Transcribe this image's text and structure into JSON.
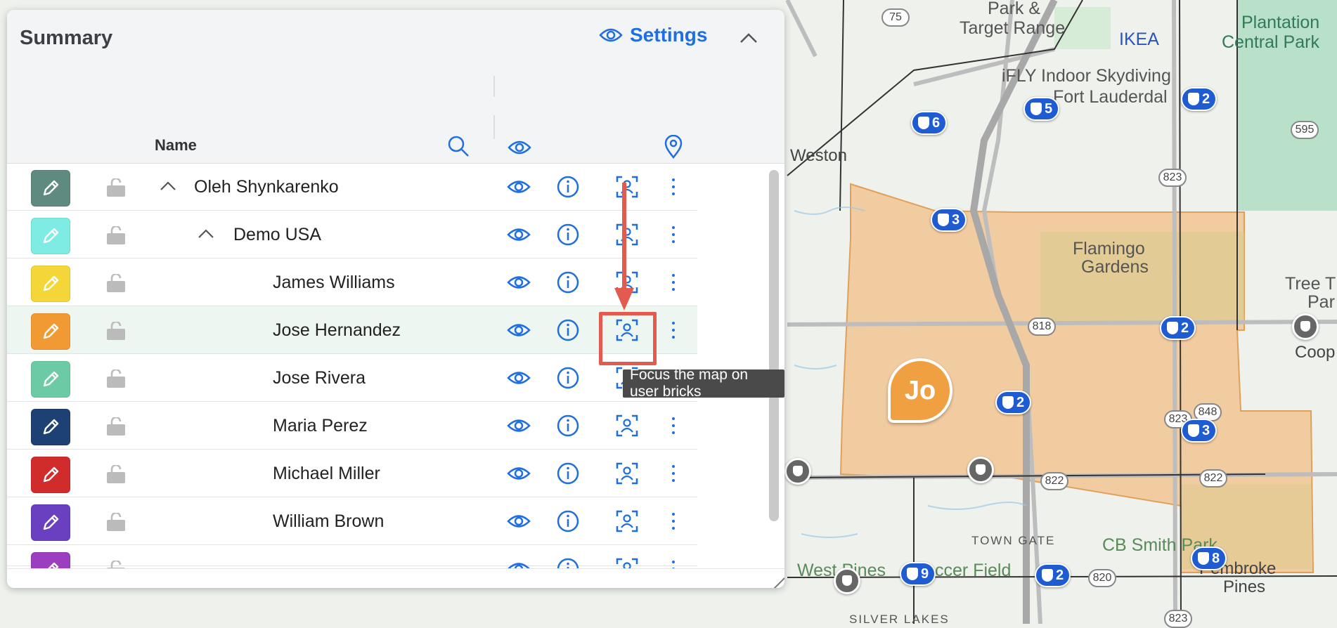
{
  "panel": {
    "title": "Summary",
    "settings_label": "Settings",
    "name_column": "Name"
  },
  "rows": [
    {
      "name": "Oleh Shynkarenko",
      "color": "#5f8a7f",
      "expanded": true,
      "level": 0
    },
    {
      "name": "Demo USA",
      "color": "#7eece3",
      "expanded": true,
      "level": 1
    },
    {
      "name": "James Williams",
      "color": "#f5d638",
      "level": 2
    },
    {
      "name": "Jose Hernandez",
      "color": "#f19a33",
      "level": 2,
      "selected": true
    },
    {
      "name": "Jose Rivera",
      "color": "#6ccba4",
      "level": 2
    },
    {
      "name": "Maria Perez",
      "color": "#1d4173",
      "level": 2
    },
    {
      "name": "Michael Miller",
      "color": "#d12c2c",
      "level": 2
    },
    {
      "name": "William Brown",
      "color": "#6a3fc0",
      "level": 2
    },
    {
      "name": "",
      "color": "#9b3fc0",
      "level": 2
    }
  ],
  "tooltip": "Focus the map on user bricks",
  "map": {
    "labels": {
      "park_range": "Park &",
      "target_range": "Target Range",
      "ikea": "IKEA",
      "plantation": "Plantation",
      "central_park": "Central Park",
      "ifly1": "iFLY Indoor Skydiving",
      "ifly2": "Fort Lauderdal",
      "weston": "Weston",
      "flamingo1": "Flamingo",
      "flamingo2": "Gardens",
      "tree1": "Tree T",
      "tree2": "Par",
      "coop": "Coop",
      "town_gate": "TOWN GATE",
      "cb_smith": "CB Smith Park",
      "west_pines": "West Pines",
      "soccer_field": "ccer Field",
      "pembroke1": "Pembroke",
      "pembroke2": "Pines",
      "silver_lakes": "SILVER LAKES"
    },
    "badges": [
      {
        "label": "6"
      },
      {
        "label": "5"
      },
      {
        "label": "2"
      },
      {
        "label": "3"
      },
      {
        "label": "2"
      },
      {
        "label": "2"
      },
      {
        "label": "3"
      },
      {
        "label": "9"
      },
      {
        "label": "2"
      },
      {
        "label": "8"
      }
    ],
    "roads": {
      "r75": "75",
      "r595": "595",
      "r823a": "823",
      "r818": "818",
      "r823b": "823",
      "r848": "848",
      "r822a": "822",
      "r822b": "822",
      "r820": "820",
      "r823c": "823"
    },
    "avatar": "Jo",
    "territory_color": "#f2c38f",
    "accent": "#1f6fe0"
  }
}
